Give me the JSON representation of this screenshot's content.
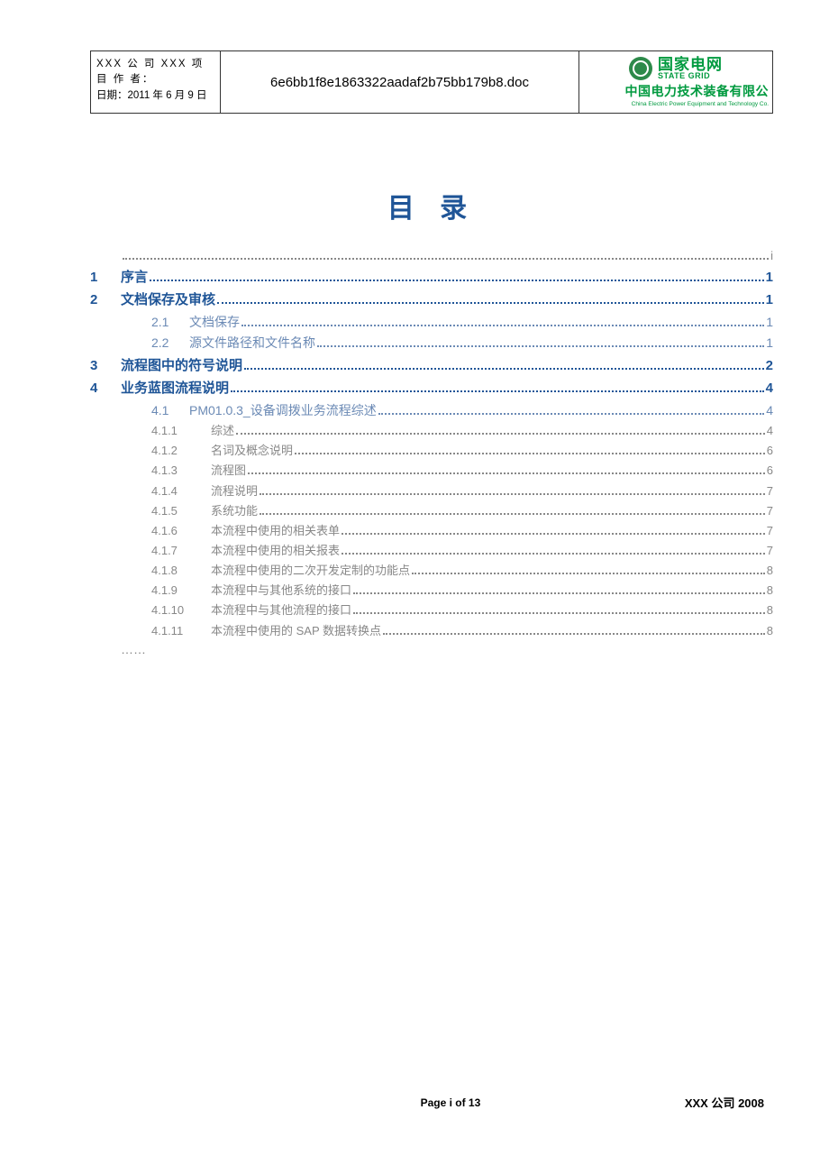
{
  "header": {
    "company_project": "XXX 公 司 XXX 项 目 作  者：",
    "date_line": "日期：2011 年 6 月 9 日",
    "middle": "6e6bb1f8e1863322aadaf2b75bb179b8.doc",
    "logo_cn": "国家电网",
    "logo_en": "STATE GRID",
    "sub_company": "中国电力技术装备有限公",
    "sub_company_en": "China Electric Power Equipment and Technology Co."
  },
  "title": "目 录",
  "toc": {
    "blank_page": "i",
    "items": [
      {
        "num": "1",
        "text": "序言",
        "page": "1",
        "level": 1
      },
      {
        "num": "2",
        "text": "文档保存及审核",
        "page": "1",
        "level": 1
      },
      {
        "num": "2.1",
        "text": "文档保存",
        "page": "1",
        "level": 2
      },
      {
        "num": "2.2",
        "text": "源文件路径和文件名称",
        "page": "1",
        "level": 2
      },
      {
        "num": "3",
        "text": "流程图中的符号说明",
        "page": "2",
        "level": 1
      },
      {
        "num": "4",
        "text": "业务蓝图流程说明",
        "page": "4",
        "level": 1
      },
      {
        "num": "4.1",
        "text": "PM01.0.3_设备调拨业务流程综述",
        "page": "4",
        "level": 2
      },
      {
        "num": "4.1.1",
        "text": "综述",
        "page": "4",
        "level": 3
      },
      {
        "num": "4.1.2",
        "text": "名词及概念说明",
        "page": "6",
        "level": 3
      },
      {
        "num": "4.1.3",
        "text": "流程图",
        "page": "6",
        "level": 3
      },
      {
        "num": "4.1.4",
        "text": "流程说明",
        "page": "7",
        "level": 3
      },
      {
        "num": "4.1.5",
        "text": "系统功能",
        "page": "7",
        "level": 3
      },
      {
        "num": "4.1.6",
        "text": "本流程中使用的相关表单",
        "page": "7",
        "level": 3
      },
      {
        "num": "4.1.7",
        "text": "本流程中使用的相关报表",
        "page": "7",
        "level": 3
      },
      {
        "num": "4.1.8",
        "text": "本流程中使用的二次开发定制的功能点",
        "page": "8",
        "level": 3
      },
      {
        "num": "4.1.9",
        "text": "本流程中与其他系统的接口",
        "page": "8",
        "level": 3
      },
      {
        "num": "4.1.10",
        "text": "本流程中与其他流程的接口",
        "page": "8",
        "level": 3
      },
      {
        "num": "4.1.11",
        "text": "本流程中使用的 SAP 数据转换点",
        "page": "8",
        "level": 3
      }
    ],
    "continuation": "……"
  },
  "footer": {
    "center": "Page i of 13",
    "right": "XXX 公司 2008"
  }
}
